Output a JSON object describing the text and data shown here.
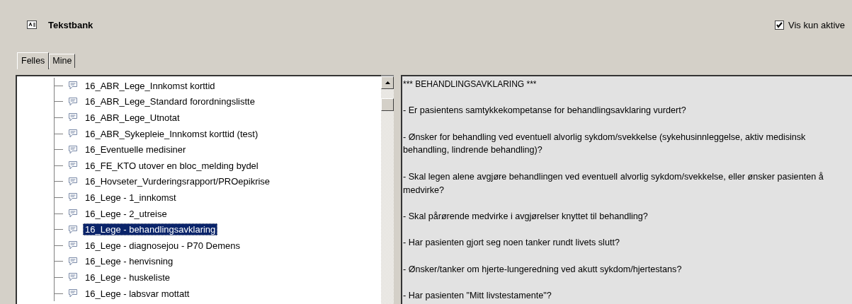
{
  "header": {
    "title": "Tekstbank",
    "filter": {
      "label": "Vis kun aktive",
      "checked": true
    }
  },
  "tabs": [
    {
      "label": "Felles",
      "selected": true
    },
    {
      "label": "Mine",
      "selected": false
    }
  ],
  "tree": {
    "items": [
      {
        "label": "16_ABR_Lege_Innkomst korttid",
        "selected": false
      },
      {
        "label": "16_ABR_Lege_Standard forordningslistte",
        "selected": false
      },
      {
        "label": "16_ABR_Lege_Utnotat",
        "selected": false
      },
      {
        "label": "16_ABR_Sykepleie_Innkomst korttid (test)",
        "selected": false
      },
      {
        "label": "16_Eventuelle medisiner",
        "selected": false
      },
      {
        "label": "16_FE_KTO utover en bloc_melding bydel",
        "selected": false
      },
      {
        "label": "16_Hovseter_Vurderingsrapport/PROepikrise",
        "selected": false
      },
      {
        "label": "16_Lege - 1_innkomst",
        "selected": false
      },
      {
        "label": "16_Lege - 2_utreise",
        "selected": false
      },
      {
        "label": "16_Lege - behandlingsavklaring",
        "selected": true
      },
      {
        "label": "16_Lege - diagnosejou - P70 Demens",
        "selected": false
      },
      {
        "label": "16_Lege - henvisning",
        "selected": false
      },
      {
        "label": "16_Lege - huskeliste",
        "selected": false
      },
      {
        "label": "16_Lege - labsvar mottatt",
        "selected": false
      }
    ]
  },
  "preview": {
    "paragraphs": [
      "*** BEHANDLINGSAVKLARING ***",
      "- Er pasientens samtykkekompetanse for behandlingsavklaring vurdert?",
      "- Ønsker for behandling ved eventuell alvorlig sykdom/svekkelse (sykehusinnleggelse, aktiv medisinsk behandling, lindrende behandling)?",
      "- Skal legen alene avgjøre behandlingen ved eventuell alvorlig sykdom/svekkelse, eller ønsker pasienten å medvirke?",
      "- Skal pårørende medvirke i avgjørelser knyttet til behandling?",
      "- Har pasienten gjort seg noen tanker rundt livets slutt?",
      "- Ønsker/tanker om hjerte-lungeredning ved akutt sykdom/hjertestans?",
      "- Har pasienten \"Mitt livstestamente\"?"
    ]
  }
}
